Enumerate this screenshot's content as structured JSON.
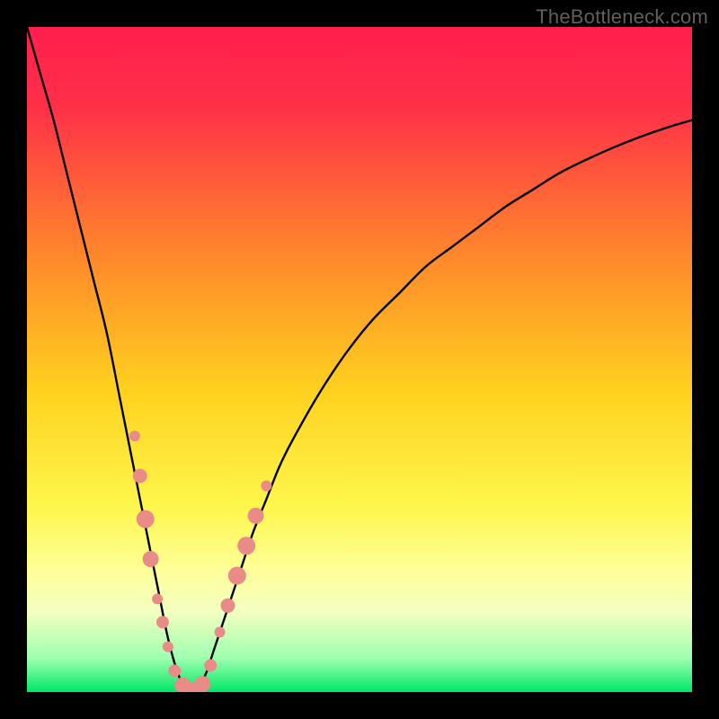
{
  "watermark": "TheBottleneck.com",
  "chart_data": {
    "type": "line",
    "title": "",
    "xlabel": "",
    "ylabel": "",
    "xlim": [
      0,
      100
    ],
    "ylim": [
      0,
      100
    ],
    "grid": false,
    "legend": false,
    "gradient_stops": [
      {
        "offset": 0,
        "color": "#ff1f4d"
      },
      {
        "offset": 0.12,
        "color": "#ff3048"
      },
      {
        "offset": 0.35,
        "color": "#ff8a2a"
      },
      {
        "offset": 0.55,
        "color": "#ffd21f"
      },
      {
        "offset": 0.72,
        "color": "#fef64c"
      },
      {
        "offset": 0.82,
        "color": "#feff9a"
      },
      {
        "offset": 0.88,
        "color": "#f3ffc0"
      },
      {
        "offset": 0.95,
        "color": "#9cffb0"
      },
      {
        "offset": 1.0,
        "color": "#00e765"
      }
    ],
    "series": [
      {
        "name": "bottleneck-curve",
        "color": "#000000",
        "x": [
          0,
          2,
          4,
          6,
          8,
          10,
          12,
          14,
          16,
          18,
          19,
          20,
          21,
          22,
          23,
          24,
          25,
          26,
          27,
          28,
          30,
          32,
          34,
          36,
          38,
          40,
          44,
          48,
          52,
          56,
          60,
          64,
          68,
          72,
          76,
          80,
          84,
          88,
          92,
          96,
          100
        ],
        "y": [
          100,
          93,
          86,
          78,
          70,
          62,
          54,
          44,
          34,
          24,
          19,
          14,
          9,
          5,
          2,
          0,
          0,
          1,
          3,
          6,
          12,
          18,
          24,
          29,
          34,
          38,
          45,
          51,
          56,
          60,
          64,
          67,
          70,
          73,
          75.5,
          78,
          80,
          81.8,
          83.4,
          84.8,
          86
        ]
      }
    ],
    "markers": {
      "name": "highlight-points",
      "color": "#e98b87",
      "points": [
        {
          "x": 16.2,
          "y": 38.5,
          "r": 6
        },
        {
          "x": 17.0,
          "y": 32.5,
          "r": 8
        },
        {
          "x": 17.8,
          "y": 26.0,
          "r": 10
        },
        {
          "x": 18.6,
          "y": 20.0,
          "r": 9
        },
        {
          "x": 19.6,
          "y": 14.0,
          "r": 6
        },
        {
          "x": 20.4,
          "y": 10.5,
          "r": 7
        },
        {
          "x": 21.2,
          "y": 6.8,
          "r": 6
        },
        {
          "x": 22.2,
          "y": 3.2,
          "r": 7
        },
        {
          "x": 23.4,
          "y": 1.0,
          "r": 9
        },
        {
          "x": 25.0,
          "y": 0.2,
          "r": 10
        },
        {
          "x": 26.4,
          "y": 1.2,
          "r": 9
        },
        {
          "x": 27.6,
          "y": 4.0,
          "r": 7
        },
        {
          "x": 29.0,
          "y": 9.0,
          "r": 6
        },
        {
          "x": 30.2,
          "y": 13.0,
          "r": 8
        },
        {
          "x": 31.6,
          "y": 17.5,
          "r": 10
        },
        {
          "x": 33.0,
          "y": 22.0,
          "r": 10
        },
        {
          "x": 34.4,
          "y": 26.5,
          "r": 9
        },
        {
          "x": 36.0,
          "y": 31.0,
          "r": 6
        }
      ]
    }
  }
}
